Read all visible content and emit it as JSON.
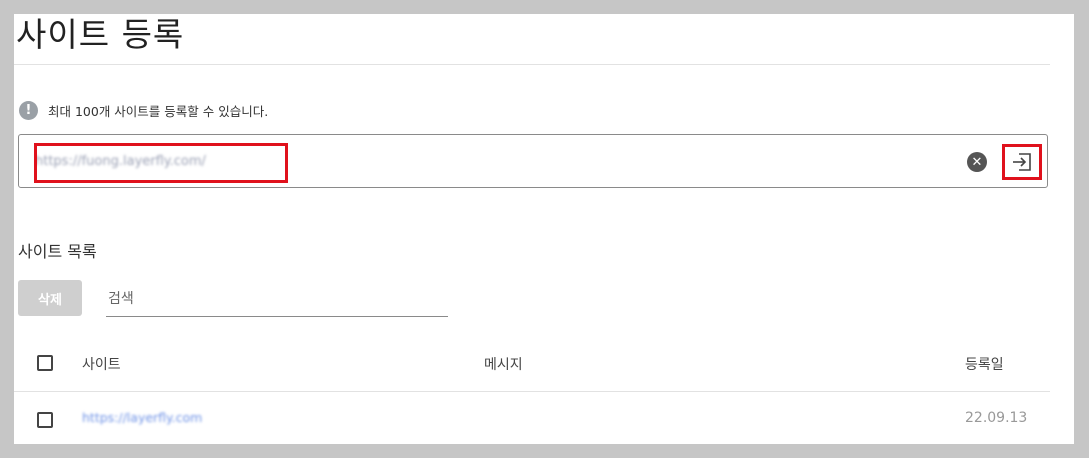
{
  "page": {
    "title": "사이트 등록",
    "info_text": "최대 100개 사이트를 등록할 수 있습니다.",
    "info_icon": "!"
  },
  "url_input": {
    "value": "https://fuong.layerfly.com/",
    "clear_icon": "✕",
    "submit_icon": "enter-arrow-icon"
  },
  "site_list": {
    "title": "사이트 목록",
    "delete_label": "삭제",
    "search_placeholder": "검색",
    "columns": {
      "site": "사이트",
      "message": "메시지",
      "registered": "등록일"
    },
    "rows": [
      {
        "site": "https://layerfly.com",
        "message": "",
        "registered": "22.09.13"
      }
    ]
  },
  "colors": {
    "highlight": "#e0111c",
    "link": "#6e92e6",
    "date": "#999999"
  }
}
